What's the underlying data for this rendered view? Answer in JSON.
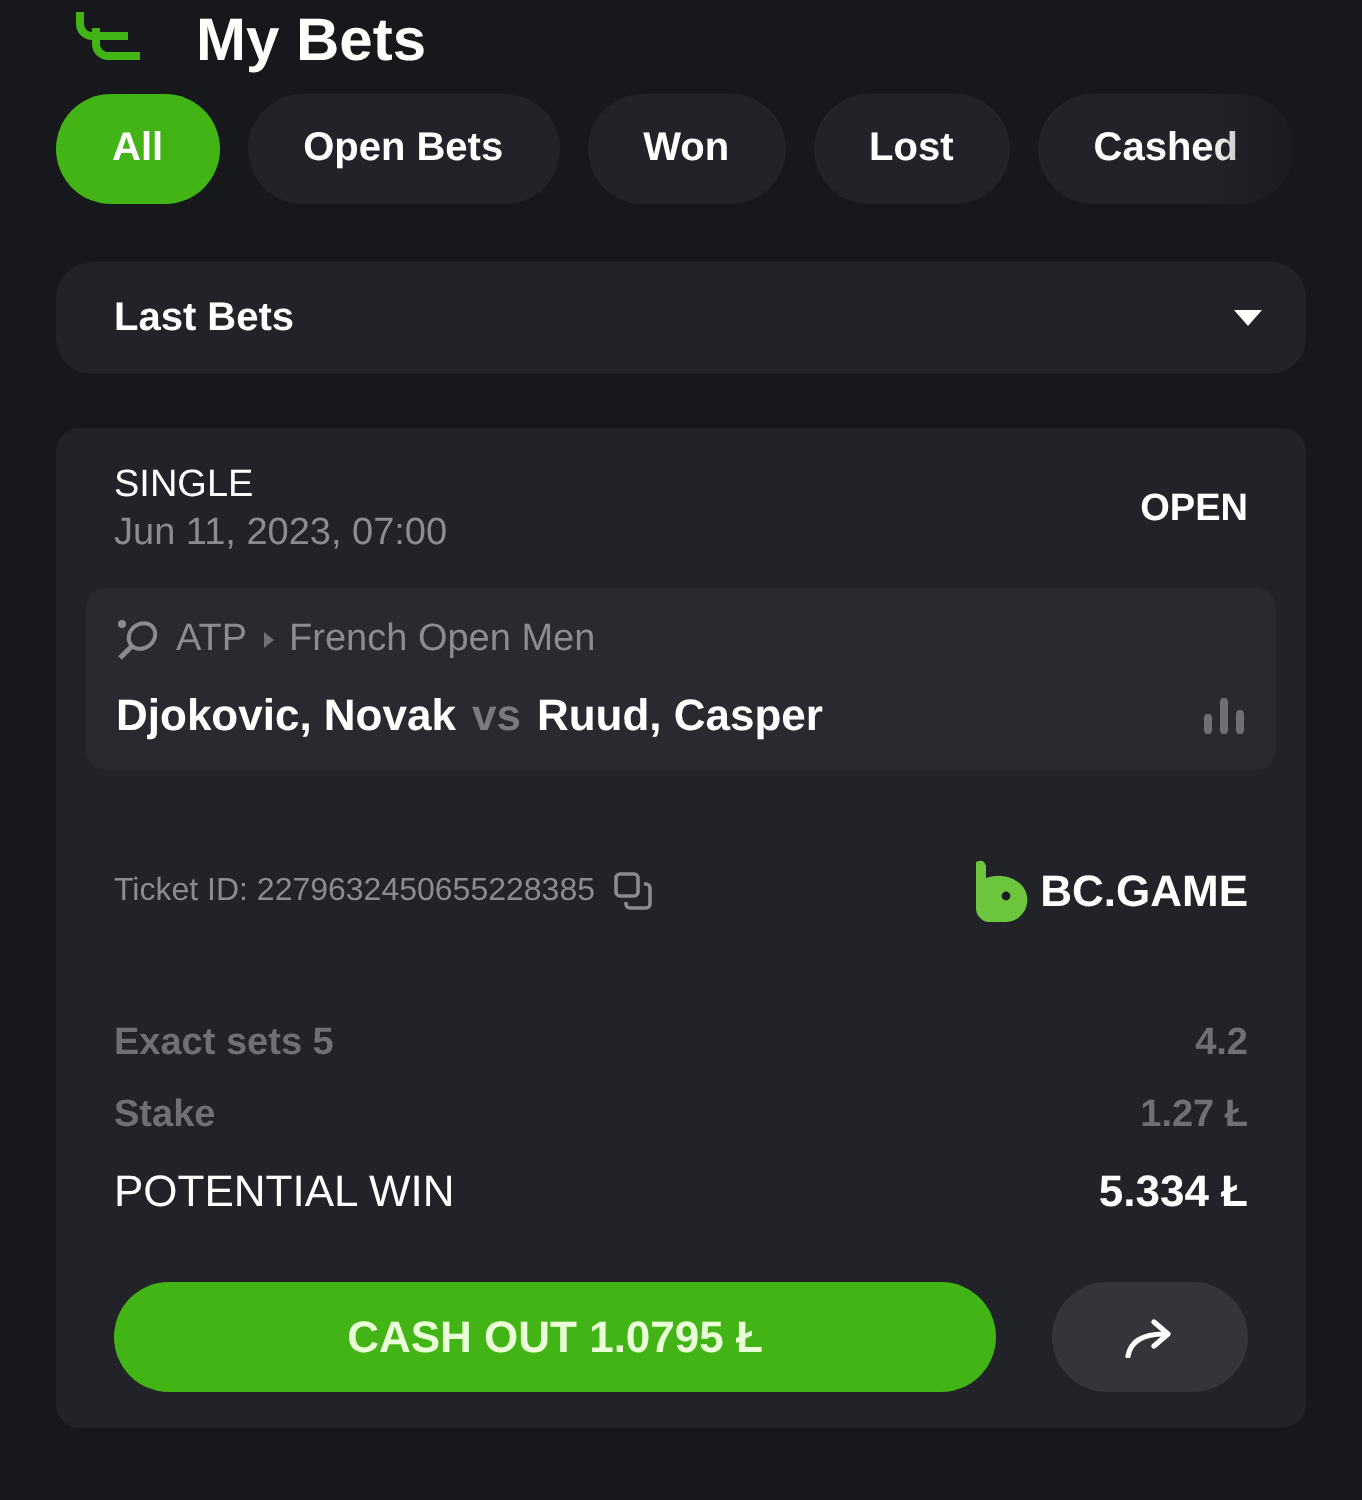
{
  "header": {
    "title": "My Bets"
  },
  "tabs": [
    {
      "label": "All",
      "selected": true
    },
    {
      "label": "Open Bets",
      "selected": false
    },
    {
      "label": "Won",
      "selected": false
    },
    {
      "label": "Lost",
      "selected": false
    },
    {
      "label": "Cashed",
      "selected": false
    }
  ],
  "filter": {
    "value": "Last Bets"
  },
  "bet": {
    "type": "SINGLE",
    "date": "Jun 11, 2023, 07:00",
    "status": "OPEN",
    "event": {
      "league": "ATP",
      "tournament": "French Open Men",
      "home": "Djokovic, Novak",
      "separator": "vs",
      "away": "Ruud, Casper"
    },
    "ticket": "Ticket ID: 2279632450655228385",
    "brand": "BC.GAME",
    "rows": [
      {
        "label": "Exact sets 5",
        "value": "4.2",
        "kind": "minor"
      },
      {
        "label": "Stake",
        "value": "1.27 Ł",
        "kind": "minor"
      },
      {
        "label": "POTENTIAL WIN",
        "value": "5.334 Ł",
        "kind": "major"
      }
    ],
    "cashout": "CASH OUT 1.0795 Ł"
  }
}
